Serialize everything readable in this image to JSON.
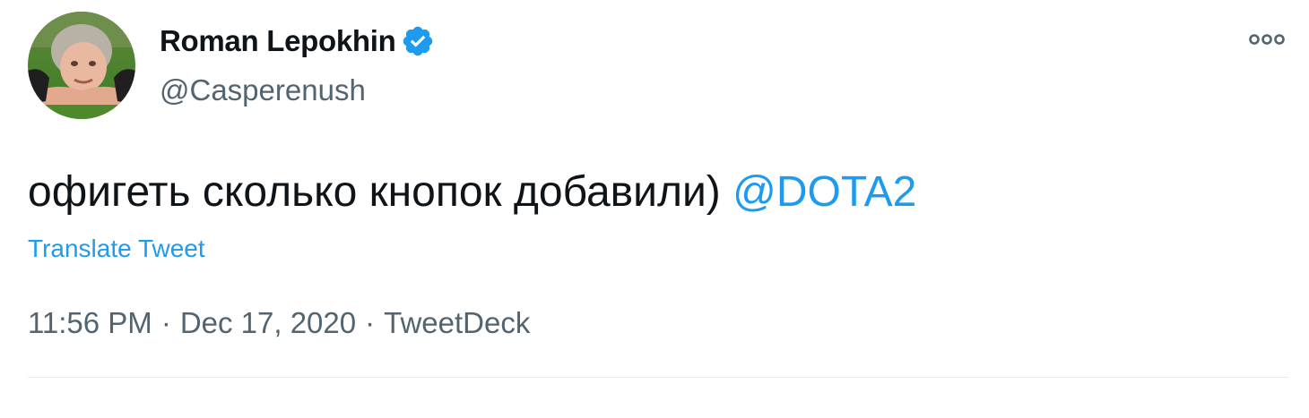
{
  "author": {
    "display_name": "Roman Lepokhin",
    "handle": "@Casperenush",
    "verified": true,
    "avatar_icon": "user-avatar-photo"
  },
  "tweet": {
    "text": "офигеть сколько кнопок добавили)",
    "mention": "@DOTA2",
    "translate_label": "Translate Tweet",
    "time": "11:56 PM",
    "date": "Dec 17, 2020",
    "source": "TweetDeck",
    "separator": "·"
  },
  "icons": {
    "more": "more-options-icon",
    "verified": "verified-badge-icon"
  },
  "colors": {
    "accent": "#1d9bf0",
    "text_primary": "#0f1419",
    "text_secondary": "#536471",
    "divider": "#e6ecf0"
  }
}
